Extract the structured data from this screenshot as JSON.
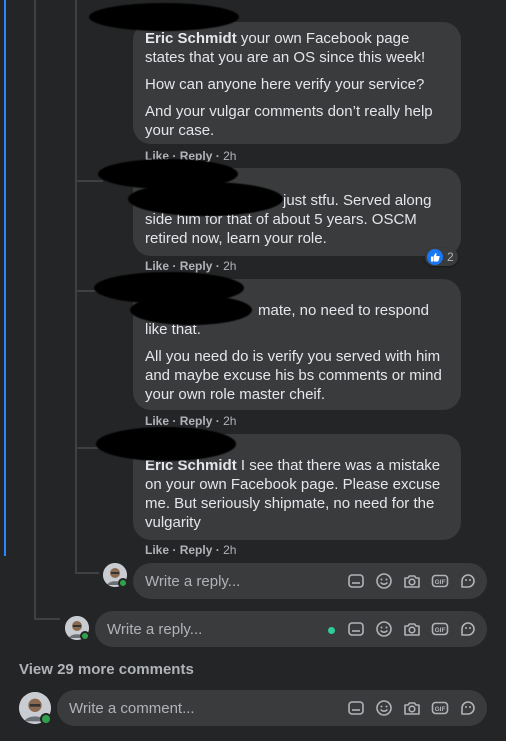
{
  "comments": [
    {
      "author": "Eric Schmidt",
      "paragraphs": [
        "your own Facebook page states that you are an OS since this week!",
        "How can anyone here verify your service?",
        "And your vulgar comments don’t really help your case."
      ],
      "actions": {
        "like": "Like",
        "reply": "Reply",
        "time": "2h"
      }
    },
    {
      "paragraphs": [
        "just stfu. Served along side him for that of about 5 years. OSCM retired now, learn your role."
      ],
      "reaction_count": "2",
      "actions": {
        "like": "Like",
        "reply": "Reply",
        "time": "2h"
      }
    },
    {
      "paragraphs": [
        "mate, no need to respond like that.",
        "All you need do is verify you served with him and maybe excuse his bs comments or mind your own role master cheif."
      ],
      "actions": {
        "like": "Like",
        "reply": "Reply",
        "time": "2h"
      }
    },
    {
      "author": "Eric Schmidt",
      "paragraphs": [
        "I see that there was a mistake on your own Facebook page. Please excuse me. But seriously shipmate, no need for the vulgarity"
      ],
      "actions": {
        "like": "Like",
        "reply": "Reply",
        "time": "2h"
      }
    }
  ],
  "separator": "·",
  "reply_box_nested": {
    "placeholder": "Write a reply..."
  },
  "reply_box_thread": {
    "placeholder": "Write a reply..."
  },
  "view_more": "View 29 more comments",
  "comment_box": {
    "placeholder": "Write a comment..."
  },
  "icons": [
    "sticker-icon",
    "emoji-icon",
    "camera-icon",
    "gif-icon",
    "avatar-sticker-icon"
  ],
  "colors": {
    "like_blue": "#1877f2",
    "online_green": "#31a24c",
    "accent": "#2d88ff"
  }
}
